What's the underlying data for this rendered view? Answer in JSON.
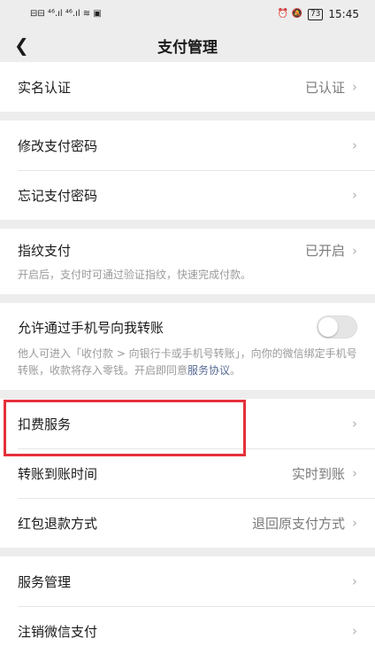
{
  "status_bar": {
    "left_icons": "⊟⊟ ⁴⁶.ıl ⁴⁶.ıl ≋ ▣",
    "right_icons": "⏰ 🔕",
    "battery": "73",
    "time": "15:45"
  },
  "header": {
    "back_icon": "chevron-left-icon",
    "title": "支付管理"
  },
  "sections": {
    "identity": {
      "label": "实名认证",
      "value": "已认证"
    },
    "password": {
      "change": "修改支付密码",
      "forgot": "忘记支付密码"
    },
    "fingerprint": {
      "label": "指纹支付",
      "value": "已开启",
      "desc": "开启后，支付时可通过验证指纹，快速完成付款。"
    },
    "phone_transfer": {
      "label": "允许通过手机号向我转账",
      "toggle_on": false,
      "desc": "他人可进入「收付款 > 向银行卡或手机号转账」，向你的微信绑定手机号转账，收款将存入零钱。开启即同意",
      "link": "服务协议",
      "desc_end": "。"
    },
    "services": {
      "deduction": "扣费服务",
      "arrival_label": "转账到账时间",
      "arrival_value": "实时到账",
      "refund_label": "红包退款方式",
      "refund_value": "退回原支付方式"
    },
    "manage": {
      "service_mgmt": "服务管理",
      "cancel_pay": "注销微信支付"
    }
  },
  "colors": {
    "highlight": "#e5303a",
    "link": "#576b95",
    "background": "#ededed"
  },
  "chevron": "›"
}
